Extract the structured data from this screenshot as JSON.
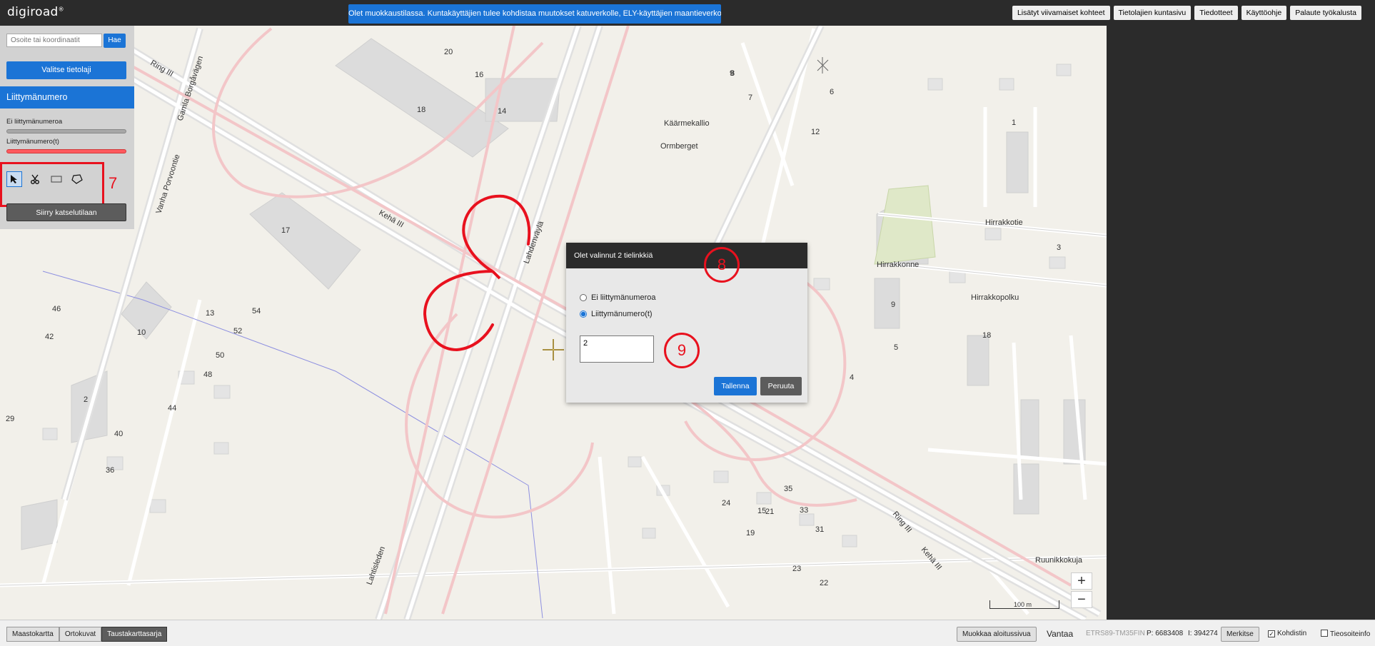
{
  "topbar": {
    "logo": "digiroad",
    "logo_mark": "®",
    "notice": "Olet muokkaustilassa. Kuntakäyttäjien tulee kohdistaa muutokset katuverkolle, ELY-käyttäjien maantieverkolle.",
    "links": [
      "Lisätyt viivamaiset kohteet",
      "Tietolajien kuntasivu",
      "Tiedotteet",
      "Käyttöohje",
      "Palaute työkalusta"
    ]
  },
  "sidebar": {
    "search_placeholder": "Osoite tai koordinaatit",
    "search_button": "Hae",
    "select_layer_button": "Valitse tietolaji",
    "layer_title": "Liittymänumero",
    "legend": [
      {
        "label": "Ei liittymänumeroa",
        "color": "#a7a7a7"
      },
      {
        "label": "Liittymänumero(t)",
        "color": "#ff5a5f"
      }
    ],
    "tools": [
      "select-tool",
      "cut-tool",
      "rectangle-tool",
      "polygon-tool"
    ],
    "annotation_number": "7",
    "view_mode_button": "Siirry katselutilaan"
  },
  "map": {
    "place_names": [
      "Käärmekallio",
      "Ormberget"
    ],
    "road_labels": [
      "Ring III",
      "Kehä III",
      "Lahdenväylä",
      "Lahtisleden",
      "Gamla Borgåvägen",
      "Vanha Porvoontie",
      "Hirrakkotie",
      "Hirrakkopolku",
      "Hirrakkonne",
      "Ruunikkokuja",
      "Ring III",
      "Kehä III"
    ],
    "house_numbers": [
      "18",
      "14",
      "16",
      "20",
      "8",
      "7",
      "9",
      "6",
      "17",
      "13",
      "52",
      "54",
      "10",
      "50",
      "48",
      "44",
      "40",
      "36",
      "42",
      "46",
      "2",
      "4",
      "5",
      "3",
      "1",
      "9",
      "12",
      "15",
      "18",
      "24",
      "31",
      "33",
      "35",
      "29",
      "19",
      "22",
      "21",
      "23"
    ],
    "zoom_in": "+",
    "zoom_out": "−",
    "scale": "100 m"
  },
  "dialog": {
    "title": "Olet valinnut 2 tielinkkiä",
    "annotation_title": "8",
    "options": [
      {
        "label": "Ei liittymänumeroa",
        "selected": false
      },
      {
        "label": "Liittymänumero(t)",
        "selected": true
      }
    ],
    "value": "2",
    "annotation_value": "9",
    "save_button": "Tallenna",
    "cancel_button": "Peruuta"
  },
  "bottombar": {
    "base_layers": [
      "Maastokartta",
      "Ortokuvat",
      "Taustakarttasarja"
    ],
    "active_base_layer": "Taustakarttasarja",
    "edit_start_button": "Muokkaa aloitussivua",
    "municipality": "Vantaa",
    "coord_system": "ETRS89-TM35FIN",
    "coord_p": "P: 6683408",
    "coord_i": "I: 394274",
    "mark_button": "Merkitse",
    "crosshair_label": "Kohdistin",
    "crosshair_checked": true,
    "road_address_label": "Tieosoiteinfo",
    "road_address_checked": false
  }
}
